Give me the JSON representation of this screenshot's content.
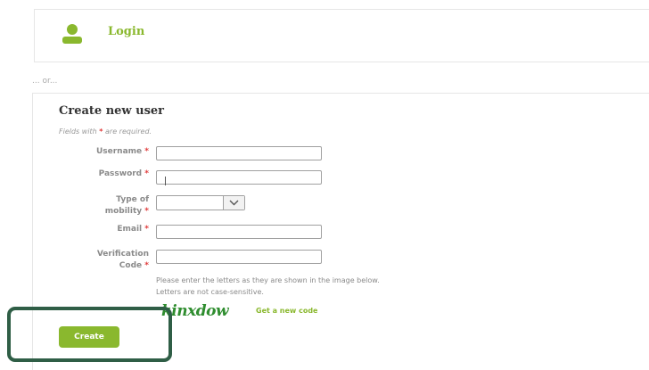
{
  "login": {
    "label": "Login",
    "icon": "user-icon"
  },
  "or_separator": "... or...",
  "create_user": {
    "title": "Create new user",
    "required_note_prefix": "Fields with",
    "required_note_suffix": "are required.",
    "required_marker": "*"
  },
  "fields": {
    "username": {
      "label": "Username",
      "value": ""
    },
    "password": {
      "label": "Password",
      "value": ""
    },
    "mobility": {
      "label_line1": "Type of",
      "label_line2": "mobility",
      "selected": ""
    },
    "email": {
      "label": "Email",
      "value": ""
    },
    "verification": {
      "label_line1": "Verification",
      "label_line2": "Code",
      "value": ""
    }
  },
  "captcha": {
    "help_line1": "Please enter the letters as they are shown in the image below.",
    "help_line2": "Letters are not case-sensitive.",
    "image_text": "kinxdow",
    "new_code_label": "Get a new code"
  },
  "buttons": {
    "create": "Create"
  },
  "colors": {
    "accent": "#8ab82e",
    "required": "#e03a3a",
    "highlight": "#2f5e46"
  }
}
